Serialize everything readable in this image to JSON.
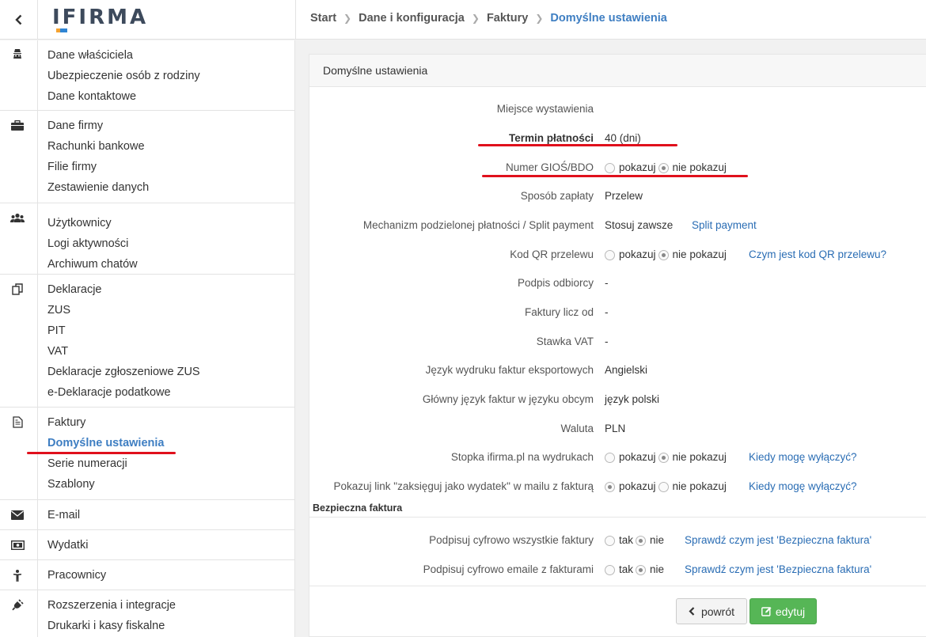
{
  "logo": {
    "text": "IFIRMA"
  },
  "breadcrumb": [
    "Start",
    "Dane i konfiguracja",
    "Faktury",
    "Domyślne ustawienia"
  ],
  "sidebar": {
    "groups": [
      {
        "icon": "owner-icon",
        "items": [
          "Dane właściciela",
          "Ubezpieczenie osób z rodziny",
          "Dane kontaktowe"
        ]
      },
      {
        "icon": "briefcase-icon",
        "items": [
          "Dane firmy",
          "Rachunki bankowe",
          "Filie firmy",
          "Zestawienie danych"
        ]
      },
      {
        "icon": "users-icon",
        "items": [
          "Użytkownicy",
          "Logi aktywności",
          "Archiwum chatów"
        ]
      },
      {
        "icon": "documents-icon",
        "items": [
          "Deklaracje",
          "ZUS",
          "PIT",
          "VAT",
          "Deklaracje zgłoszeniowe ZUS",
          "e-Deklaracje podatkowe"
        ]
      },
      {
        "icon": "invoice-icon",
        "items": [
          "Faktury",
          "Domyślne ustawienia",
          "Serie numeracji",
          "Szablony"
        ]
      },
      {
        "icon": "envelope-icon",
        "items": [
          "E-mail"
        ]
      },
      {
        "icon": "money-icon",
        "items": [
          "Wydatki"
        ]
      },
      {
        "icon": "worker-icon",
        "items": [
          "Pracownicy"
        ]
      },
      {
        "icon": "plug-icon",
        "items": [
          "Rozszerzenia i integracje",
          "Drukarki i kasy fiskalne"
        ]
      }
    ],
    "active_item": "Domyślne ustawienia"
  },
  "panel": {
    "title": "Domyślne ustawienia",
    "rows": [
      {
        "label": "Miejsce wystawienia",
        "value": ""
      },
      {
        "label": "Termin płatności",
        "value": "40 (dni)"
      },
      {
        "label": "Numer GIOŚ/BDO",
        "options": [
          "pokazuj",
          "nie pokazuj"
        ],
        "selected": "nie pokazuj"
      },
      {
        "label": "Sposób zapłaty",
        "value": "Przelew"
      },
      {
        "label": "Mechanizm podzielonej płatności / Split payment",
        "value": "Stosuj zawsze",
        "link": "Split payment"
      },
      {
        "label": "Kod QR przelewu",
        "options": [
          "pokazuj",
          "nie pokazuj"
        ],
        "selected": "nie pokazuj",
        "link": "Czym jest kod QR przelewu?"
      },
      {
        "label": "Podpis odbiorcy",
        "value": "-"
      },
      {
        "label": "Faktury licz od",
        "value": "-"
      },
      {
        "label": "Stawka VAT",
        "value": "-"
      },
      {
        "label": "Język wydruku faktur eksportowych",
        "value": "Angielski"
      },
      {
        "label": "Główny język faktur w języku obcym",
        "value": "język polski"
      },
      {
        "label": "Waluta",
        "value": "PLN"
      },
      {
        "label": "Stopka ifirma.pl na wydrukach",
        "options": [
          "pokazuj",
          "nie pokazuj"
        ],
        "selected": "nie pokazuj",
        "link": "Kiedy mogę wyłączyć?"
      },
      {
        "label": "Pokazuj link \"zaksięguj jako wydatek\" w mailu z fakturą",
        "options": [
          "pokazuj",
          "nie pokazuj"
        ],
        "selected": "pokazuj",
        "link": "Kiedy mogę wyłączyć?"
      }
    ],
    "section_title": "Bezpieczna faktura",
    "secure_rows": [
      {
        "label": "Podpisuj cyfrowo wszystkie faktury",
        "options": [
          "tak",
          "nie"
        ],
        "selected": "nie",
        "link": "Sprawdź czym jest 'Bezpieczna faktura'"
      },
      {
        "label": "Podpisuj cyfrowo emaile z fakturami",
        "options": [
          "tak",
          "nie"
        ],
        "selected": "nie",
        "link": "Sprawdź czym jest 'Bezpieczna faktura'"
      }
    ],
    "buttons": {
      "back": "powrót",
      "edit": "edytuj"
    }
  },
  "colors": {
    "accent": "#3e7ec2",
    "link": "#2a6db4",
    "edit_button": "#56b656",
    "annotation": "#e0101c"
  }
}
